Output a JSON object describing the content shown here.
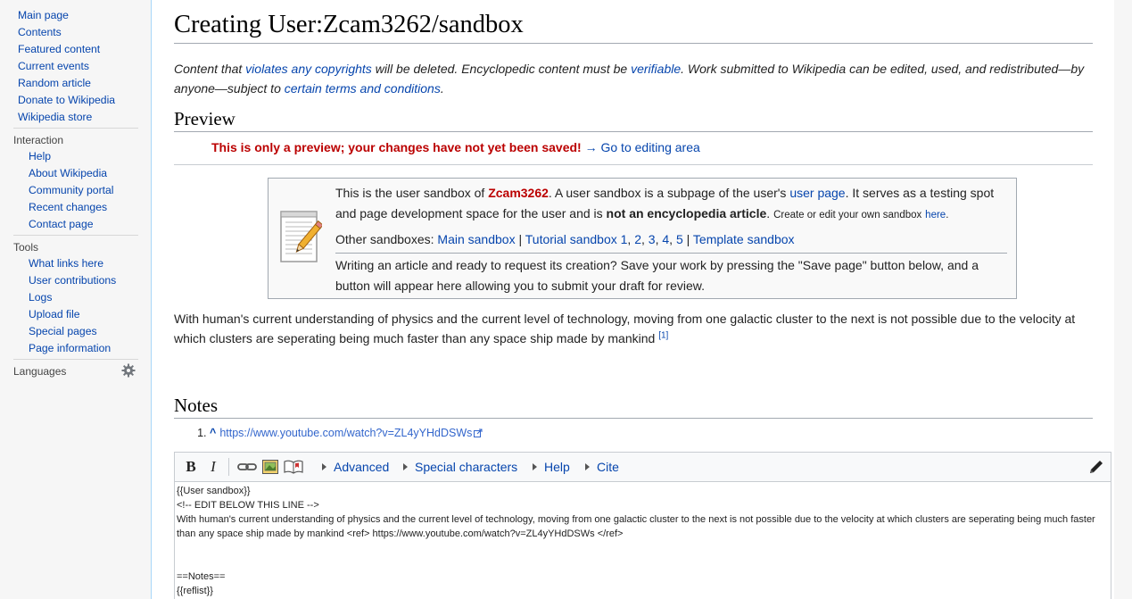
{
  "sidebar": {
    "main_links": [
      "Main page",
      "Contents",
      "Featured content",
      "Current events",
      "Random article",
      "Donate to Wikipedia",
      "Wikipedia store"
    ],
    "interaction_heading": "Interaction",
    "interaction_links": [
      "Help",
      "About Wikipedia",
      "Community portal",
      "Recent changes",
      "Contact page"
    ],
    "tools_heading": "Tools",
    "tools_links": [
      "What links here",
      "User contributions",
      "Logs",
      "Upload file",
      "Special pages",
      "Page information"
    ],
    "languages_heading": "Languages",
    "languages_icon": "gear-icon"
  },
  "page": {
    "title": "Creating User:Zcam3262/sandbox",
    "copy_warning": {
      "t1": "Content that ",
      "l1": "violates any copyrights",
      "t2": " will be deleted. Encyclopedic content must be ",
      "l2": "verifiable",
      "t3": ". Work submitted to Wikipedia can be edited, used, and redistributed—by anyone—subject to ",
      "l3": "certain terms and conditions",
      "t4": "."
    },
    "preview_heading": "Preview",
    "preview_warning": "This is only a preview; your changes have not yet been saved!",
    "preview_arrow": "→",
    "preview_link": "Go to editing area"
  },
  "sandbox_box": {
    "icon": "notepad-pencil-icon",
    "p1_a": "This is the user sandbox of ",
    "p1_user": "Zcam3262",
    "p1_b": ". A user sandbox is a subpage of the user's ",
    "p1_userpage": "user page",
    "p1_c": ". It serves as a testing spot and page development space for the user and is ",
    "p1_bold": "not an encyclopedia article",
    "p1_d": ".",
    "p1_small": "Create or edit your own sandbox",
    "p1_here": "here",
    "p1_end": ".",
    "other_label": "Other sandboxes: ",
    "main_sandbox": "Main sandbox",
    "sep": "|",
    "tutorial_sandbox": "Tutorial sandbox 1",
    "t2": "2",
    "t3": "3",
    "t4": "4",
    "t5": "5",
    "template_sandbox": "Template sandbox",
    "p3": "Writing an article and ready to request its creation? Save your work by pressing the \"Save page\" button below, and a button will appear here allowing you to submit your draft for review."
  },
  "body": {
    "paragraph": "With human's current understanding of physics and the current level of technology, moving from one galactic cluster to the next is not possible due to the velocity at which clusters are seperating being much faster than any space ship made by mankind ",
    "ref_mark": "[1]"
  },
  "notes": {
    "heading": "Notes",
    "items": [
      {
        "caret": "^",
        "url": "https://www.youtube.com/watch?v=ZL4yYHdDSWs"
      }
    ]
  },
  "editor": {
    "bold": "B",
    "italic": "I",
    "menus": [
      "Advanced",
      "Special characters",
      "Help",
      "Cite"
    ],
    "wikitext": "{{User sandbox}}\n<!-- EDIT BELOW THIS LINE -->\nWith human's current understanding of physics and the current level of technology, moving from one galactic cluster to the next is not possible due to the velocity at which clusters are seperating being much faster than any space ship made by mankind <ref> https://www.youtube.com/watch?v=ZL4yYHdDSWs </ref>\n\n\n==Notes==\n{{reflist}}"
  },
  "colors": {
    "link": "#0645ad",
    "warning": "#b00000",
    "sidebar_bg": "#f6f6f6",
    "content_border": "#a7d7f9"
  }
}
